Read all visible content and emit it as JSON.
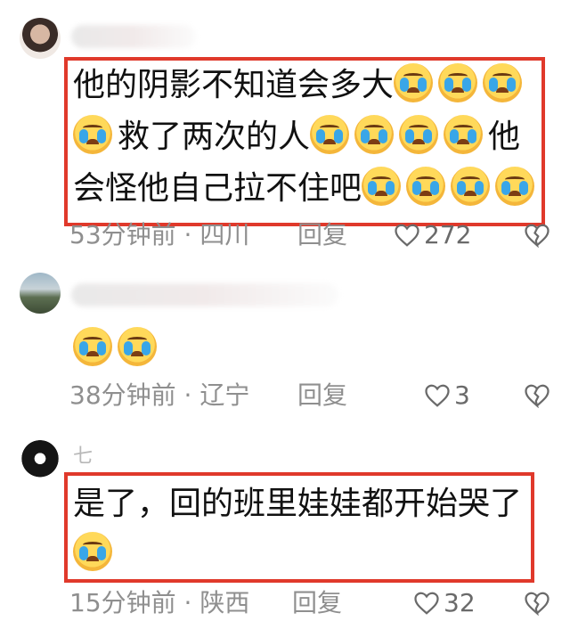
{
  "comments": [
    {
      "username": "",
      "text_lines": [
        "他的阴影不知道会多大",
        "救了两次的人",
        "他",
        "会怪他自己拉不住吧"
      ],
      "time": "53分钟前",
      "location": "四川",
      "reply_label": "回复",
      "likes": "272"
    },
    {
      "username": "",
      "text_lines": [],
      "time": "38分钟前",
      "location": "辽宁",
      "reply_label": "回复",
      "likes": "3"
    },
    {
      "username": "七",
      "text_lines": [
        "是了，回的班里娃娃都开始哭了"
      ],
      "time": "15分钟前",
      "location": "陕西",
      "reply_label": "回复",
      "likes": "32"
    }
  ],
  "icons": {
    "like": "heart-outline-icon",
    "dislike": "broken-heart-icon",
    "emoji": "loudly-crying-face-emoji"
  },
  "colors": {
    "highlight_border": "#e0392b",
    "meta_text": "#8f8f8f",
    "body_text": "#111111"
  }
}
